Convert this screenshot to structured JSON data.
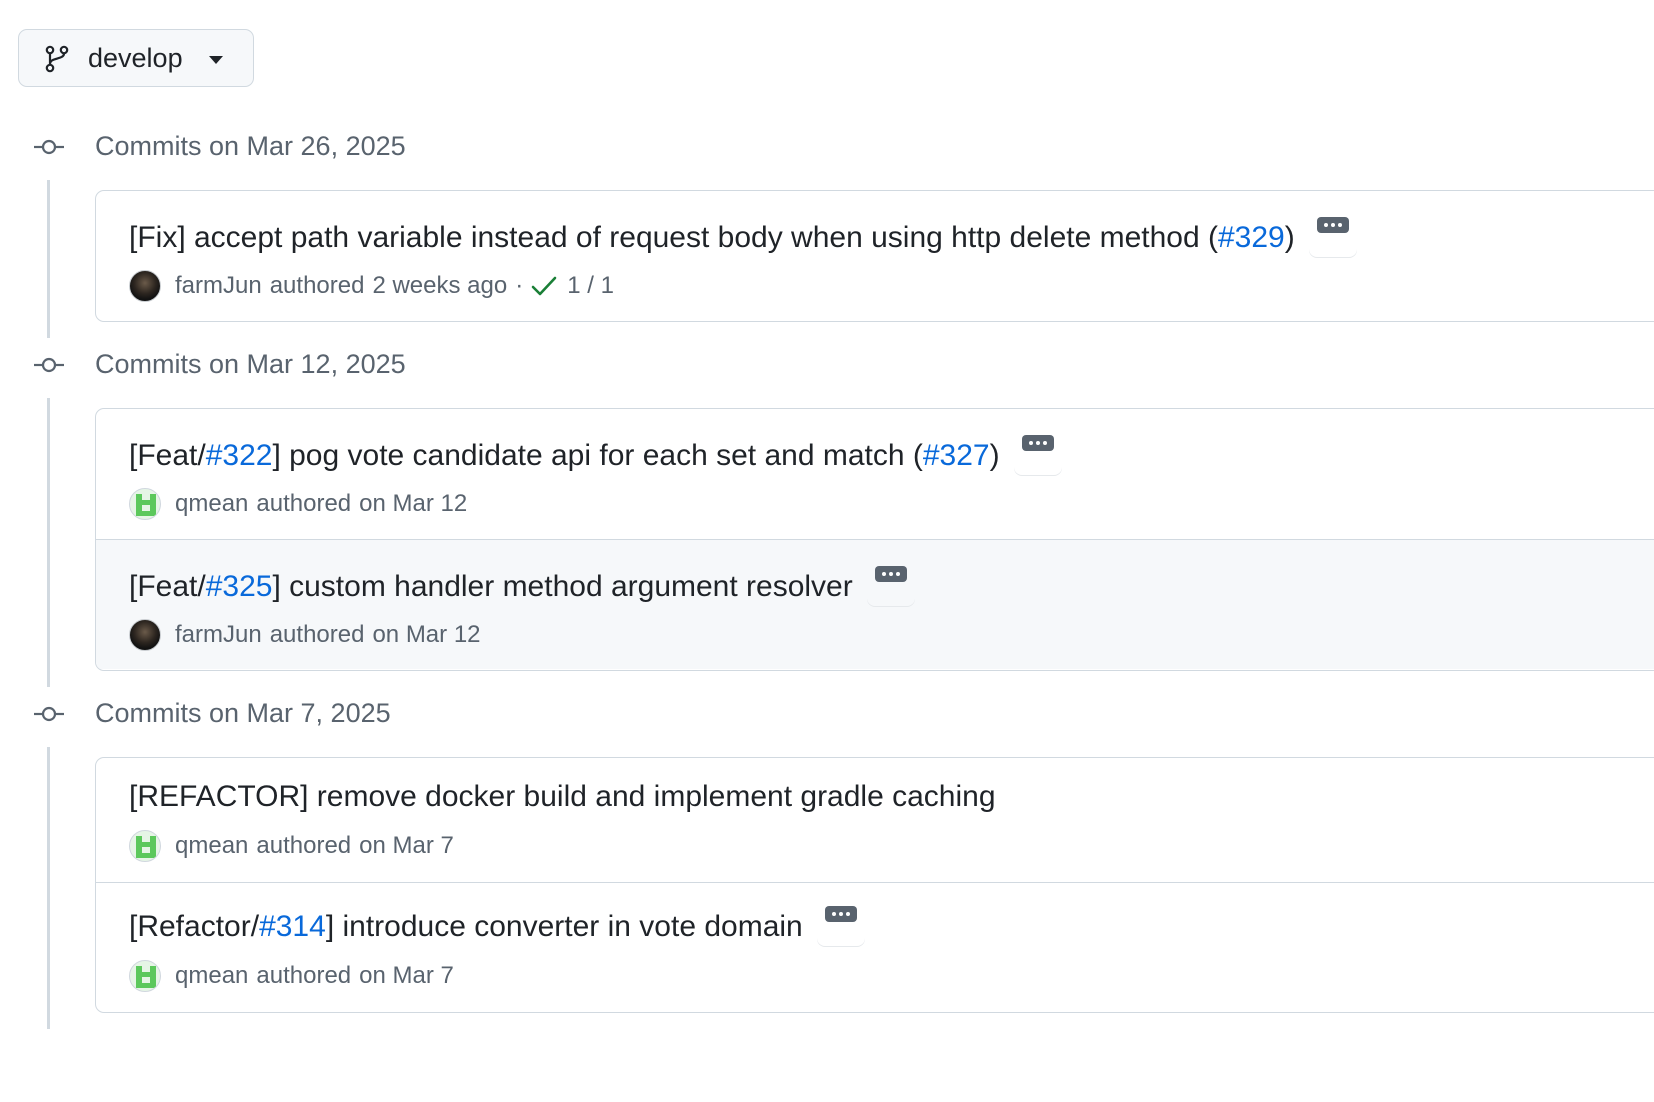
{
  "branch": {
    "name": "develop"
  },
  "groups": [
    {
      "title": "Commits on Mar 26, 2025",
      "commits": [
        {
          "prefix": "[Fix] accept path variable instead of request body when using http delete method (",
          "pr": "#329",
          "suffix": ")",
          "author": "farmJun",
          "authored": "authored",
          "time": "2 weeks ago",
          "separator": "·",
          "checks": "1 / 1"
        }
      ]
    },
    {
      "title": "Commits on Mar 12, 2025",
      "commits": [
        {
          "open": "[Feat/",
          "issue": "#322",
          "rest": "] pog vote candidate api for each set and match (",
          "pr": "#327",
          "suffix": ")",
          "author": "qmean",
          "authored": "authored",
          "time": "on Mar 12"
        },
        {
          "open": "[Feat/",
          "issue": "#325",
          "rest": "] custom handler method argument resolver",
          "author": "farmJun",
          "authored": "authored",
          "time": "on Mar 12"
        }
      ]
    },
    {
      "title": "Commits on Mar 7, 2025",
      "commits": [
        {
          "text": "[REFACTOR] remove docker build and implement gradle caching",
          "author": "qmean",
          "authored": "authored",
          "time": "on Mar 7"
        },
        {
          "open": "[Refactor/",
          "issue": "#314",
          "rest": "] introduce converter in vote domain",
          "author": "qmean",
          "authored": "authored",
          "time": "on Mar 7"
        }
      ]
    }
  ],
  "colors": {
    "link": "#0969da",
    "check": "#1a7f37",
    "muted": "#59636e",
    "border": "#d1d9e0"
  },
  "icons": [
    "git-branch-icon",
    "triangle-down-icon",
    "git-commit-icon",
    "kebab-horizontal-icon",
    "check-icon"
  ]
}
